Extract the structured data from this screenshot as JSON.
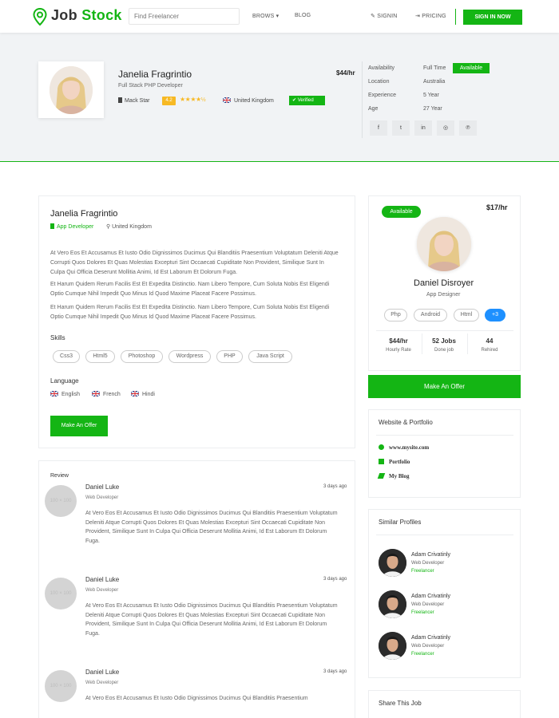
{
  "navbar": {
    "logo_text_prefix": "Job ",
    "logo_text_suffix": "Stock",
    "search_placeholder": "Find Freelancer",
    "browse": "BROWS ▾",
    "blog": "BLOG",
    "signin": "SIGNIN",
    "pricing": "PRICING",
    "signin_now": "SIGN IN NOW"
  },
  "profile": {
    "name": "Janelia Fragrintio",
    "role": "Full Stack PHP Developer",
    "company": "Mack Star",
    "rating": "4.2",
    "stars": "★★★★",
    "half_star": "½",
    "country": "United Kingdom",
    "verified": "Verified",
    "rate": "$44/hr",
    "info": [
      {
        "key": "Availability",
        "value": "Full Time"
      },
      {
        "key": "Location",
        "value": "Australia"
      },
      {
        "key": "Experience",
        "value": "5 Year"
      },
      {
        "key": "Age",
        "value": "27 Year"
      }
    ],
    "availability_badge": "Available",
    "social_icons": [
      "facebook-icon",
      "twitter-icon",
      "linkedin-icon",
      "instagram-icon",
      "pinterest-icon"
    ],
    "social_glyphs": [
      "f",
      "t",
      "in",
      "◎",
      "℗"
    ]
  },
  "about": {
    "name": "Janelia Fragrintio",
    "role": "App Developer",
    "location": "United Kingdom",
    "paragraphs": [
      "At Vero Eos Et Accusamus Et Iusto Odio Dignissimos Ducimus Qui Blanditiis Praesentium Voluptatum Deleniti Atque Corrupti Quos Dolores Et Quas Molestias Excepturi Sint Occaecati Cupiditate Non Provident, Similique Sunt In Culpa Qui Officia Deserunt Mollitia Animi, Id Est Laborum Et Dolorum Fuga.",
      "Et Harum Quidem Rerum Facilis Est Et Expedita Distinctio. Nam Libero Tempore, Cum Soluta Nobis Est Eligendi Optio Cumque Nihil Impedit Quo Minus Id Quod Maxime Placeat Facere Possimus.",
      "Et Harum Quidem Rerum Facilis Est Et Expedita Distinctio. Nam Libero Tempore, Cum Soluta Nobis Est Eligendi Optio Cumque Nihil Impedit Quo Minus Id Quod Maxime Placeat Facere Possimus."
    ],
    "skills_title": "Skills",
    "skills": [
      "Css3",
      "Html5",
      "Photoshop",
      "Wordpress",
      "PHP",
      "Java Script"
    ],
    "language_title": "Language",
    "languages": [
      "English",
      "French",
      "Hindi"
    ],
    "offer_button": "Make An Offer"
  },
  "reviews": {
    "title": "Review",
    "items": [
      {
        "name": "Daniel Luke",
        "role": "Web Developer",
        "date": "3 days ago",
        "avatar_text": "100 × 100",
        "text": "At Vero Eos Et Accusamus Et Iusto Odio Dignissimos Ducimus Qui Blanditiis Praesentium Voluptatum Deleniti Atque Corrupti Quos Dolores Et Quas Molestias Excepturi Sint Occaecati Cupiditate Non Provident, Similique Sunt In Culpa Qui Officia Deserunt Mollitia Animi, Id Est Laborum Et Dolorum Fuga."
      },
      {
        "name": "Daniel Luke",
        "role": "Web Developer",
        "date": "3 days ago",
        "avatar_text": "100 × 100",
        "text": "At Vero Eos Et Accusamus Et Iusto Odio Dignissimos Ducimus Qui Blanditiis Praesentium Voluptatum Deleniti Atque Corrupti Quos Dolores Et Quas Molestias Excepturi Sint Occaecati Cupiditate Non Provident, Similique Sunt In Culpa Qui Officia Deserunt Mollitia Animi, Id Est Laborum Et Dolorum Fuga."
      },
      {
        "name": "Daniel Luke",
        "role": "Web Developer",
        "date": "3 days ago",
        "avatar_text": "100 × 100",
        "text": "At Vero Eos Et Accusamus Et Iusto Odio Dignissimos Ducimus Qui Blanditiis Praesentium"
      }
    ]
  },
  "side_profile": {
    "availability": "Available",
    "rate": "$17/hr",
    "name": "Daniel Disroyer",
    "role": "App Designer",
    "tags": [
      "Php",
      "Android",
      "Html"
    ],
    "more": "+3",
    "stats": [
      {
        "value": "$44/hr",
        "label": "Hourly Rate"
      },
      {
        "value": "52 Jobs",
        "label": "Done job"
      },
      {
        "value": "44",
        "label": "Rehired"
      }
    ],
    "offer_button": "Make An Offer"
  },
  "website": {
    "title": "Website & Portfolio",
    "items": [
      "www.mysite.com",
      "Portfolio",
      "My Blog"
    ]
  },
  "similar": {
    "title": "Similar Profiles",
    "items": [
      {
        "name": "Adam Crivatinly",
        "role": "Web Developer",
        "badge": "Freelancer"
      },
      {
        "name": "Adam Crivatinly",
        "role": "Web Developer",
        "badge": "Freelancer"
      },
      {
        "name": "Adam Crivatinly",
        "role": "Web Developer",
        "badge": "Freelancer"
      }
    ]
  },
  "share": {
    "title": "Share This Job"
  },
  "colors": {
    "accent": "#14b514",
    "info": "#1e90ff",
    "star": "#f7b924"
  }
}
